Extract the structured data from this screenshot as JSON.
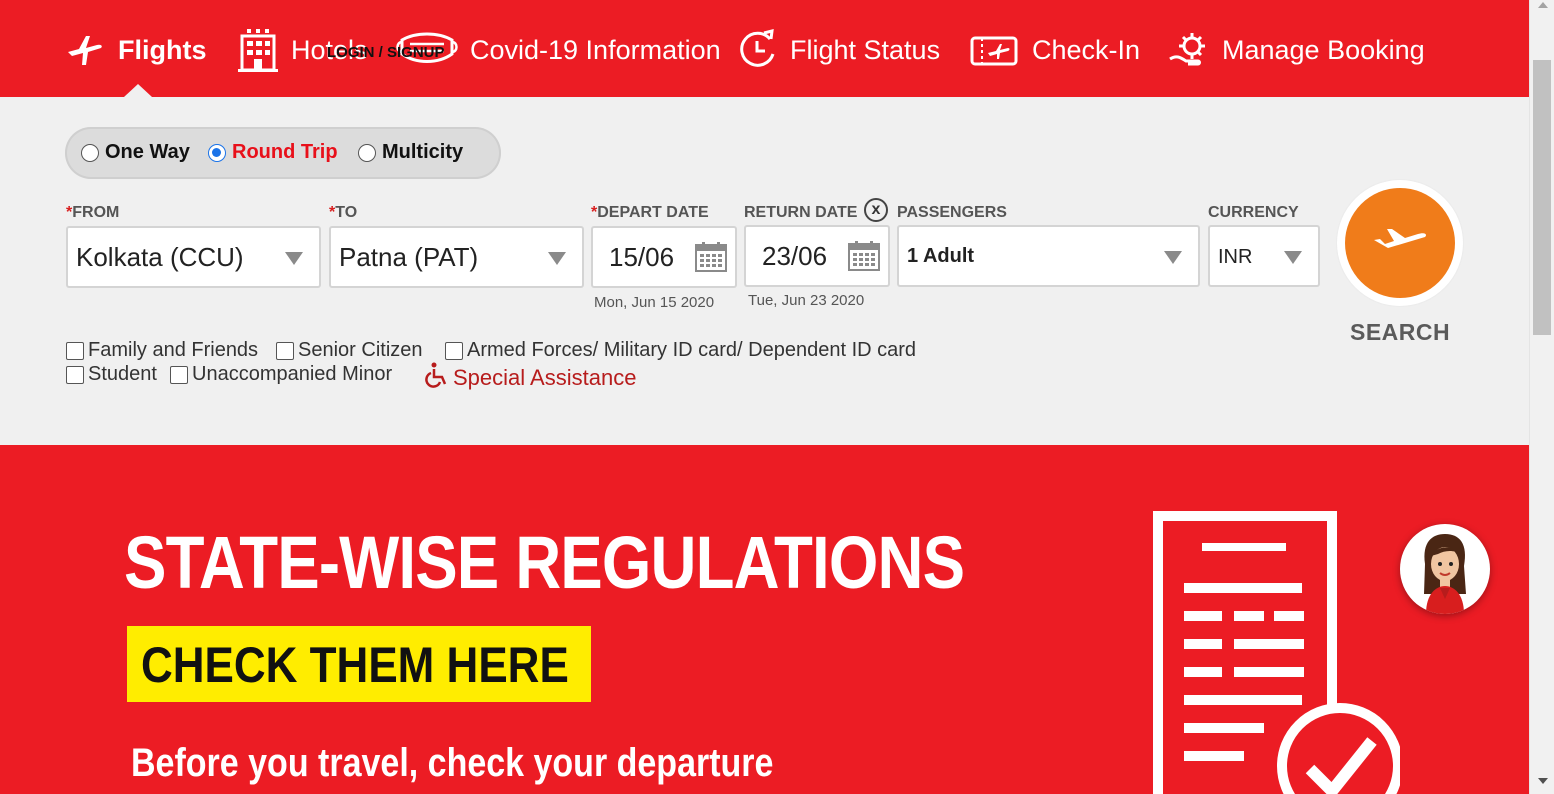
{
  "colors": {
    "brand_red": "#ec1c24",
    "search_orange": "#f07c1a",
    "panel_bg": "#f0f0f0",
    "highlight_yellow": "#ffed00",
    "link_red": "#b71c1c"
  },
  "nav": {
    "items": [
      {
        "label": "Flights",
        "icon": "airplane-icon",
        "active": true
      },
      {
        "label": "Hotels",
        "icon": "hotel-icon"
      },
      {
        "label": "Covid-19 Information",
        "icon": "mask-icon"
      },
      {
        "label": "Flight Status",
        "icon": "clock-icon"
      },
      {
        "label": "Check-In",
        "icon": "ticket-icon"
      },
      {
        "label": "Manage Booking",
        "icon": "gear-hand-icon"
      }
    ],
    "login_label": "LOGIN / SIGNUP"
  },
  "search": {
    "trip_types": [
      {
        "label": "One Way",
        "selected": false
      },
      {
        "label": "Round Trip",
        "selected": true
      },
      {
        "label": "Multicity",
        "selected": false
      }
    ],
    "from": {
      "label": "FROM",
      "value": "Kolkata (CCU)"
    },
    "to": {
      "label": "TO",
      "value": "Patna (PAT)"
    },
    "depart": {
      "label": "DEPART DATE",
      "value": "15/06",
      "full": "Mon, Jun 15 2020"
    },
    "return": {
      "label": "RETURN DATE",
      "value": "23/06",
      "full": "Tue, Jun 23 2020",
      "clear": "x"
    },
    "passengers": {
      "label": "PASSENGERS",
      "value": "1 Adult"
    },
    "currency": {
      "label": "CURRENCY",
      "value": "INR"
    },
    "search_label": "SEARCH",
    "required_mark": "*",
    "checkboxes": [
      {
        "label": "Family and Friends",
        "checked": false
      },
      {
        "label": "Senior Citizen",
        "checked": false
      },
      {
        "label": "Armed Forces/ Military ID card/ Dependent ID card",
        "checked": false
      },
      {
        "label": "Student",
        "checked": false
      },
      {
        "label": "Unaccompanied Minor",
        "checked": false
      }
    ],
    "special_assistance": {
      "label": "Special Assistance",
      "icon": "wheelchair-icon"
    }
  },
  "banner": {
    "title": "STATE-WISE REGULATIONS",
    "cta": "CHECK THEM HERE",
    "subtitle": "Before you travel, check your departure"
  }
}
